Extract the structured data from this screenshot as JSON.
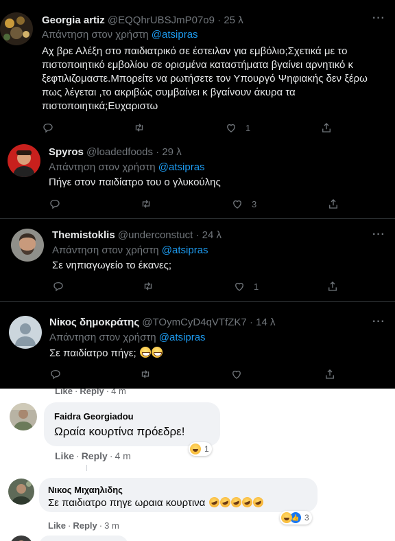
{
  "tweets": [
    {
      "name": "Georgia artiz",
      "handle": "@EQQhrUBSJmP07o9",
      "time": "25 λ",
      "reply_prefix": "Απάντηση στον χρήστη",
      "reply_to": "@atsipras",
      "body_lines": [
        "Αχ βρε Αλέξη στο παιδιατρικό σε έστειλαν για εμβόλιο;Σχετικά με το",
        "πιστοποιητικό εμβολίου σε ορισμένα καταστήματα βγαίνει αρνητικό κ",
        "ξεφτιλιζομαστε.Μπορείτε να ρωτήσετε τον Υπουργό Ψηφιακής δεν ξέρω",
        "πως λέγεται ,το ακριβώς συμβαίνει κ βγαίνουν άκυρα τα",
        "πιστοποιητικά;Ευχαριστω"
      ],
      "likes": "1"
    },
    {
      "name": "Spyros",
      "handle": "@loadedfoods",
      "time": "29 λ",
      "reply_prefix": "Απάντηση στον χρήστη",
      "reply_to": "@atsipras",
      "body": "Πήγε στον παιδίατρο του ο γλυκούλης",
      "likes": "3"
    },
    {
      "name": "Themistoklis",
      "handle": "@underconstuct",
      "time": "24 λ",
      "reply_prefix": "Απάντηση στον χρήστη",
      "reply_to": "@atsipras",
      "body": "Σε νηπιαγωγείο το έκανες;",
      "likes": "1"
    },
    {
      "name": "Νίκος δημοκράτης",
      "handle": "@TOymCyD4qVTfZK7",
      "time": "14 λ",
      "reply_prefix": "Απάντηση στον χρήστη",
      "reply_to": "@atsipras",
      "body": "Σε παιδίατρο πήγε;",
      "likes": ""
    }
  ],
  "more_label": "···",
  "dot": "·",
  "facebook": {
    "top_meta": {
      "like": "Like",
      "reply": "Reply",
      "time": "4 m"
    },
    "comments": [
      {
        "name": "Faidra Georgiadou",
        "text": "Ωραία κουρτίνα πρόεδρε!",
        "reaction_count": "1",
        "meta": {
          "like": "Like",
          "reply": "Reply",
          "time": "4 m"
        }
      },
      {
        "name": "Νικος Μιχαηλιδης",
        "text": "Σε παιδιατρο πηγε ωραια κουρτινα",
        "reaction_count": "3",
        "meta": {
          "like": "Like",
          "reply": "Reply",
          "time": "3 m"
        }
      }
    ]
  },
  "colors": {
    "twitter_bg": "#000000",
    "twitter_link": "#1d9bf0",
    "twitter_muted": "#71767b",
    "fb_bubble": "#f0f2f5",
    "fb_like_blue": "#1877f2"
  }
}
